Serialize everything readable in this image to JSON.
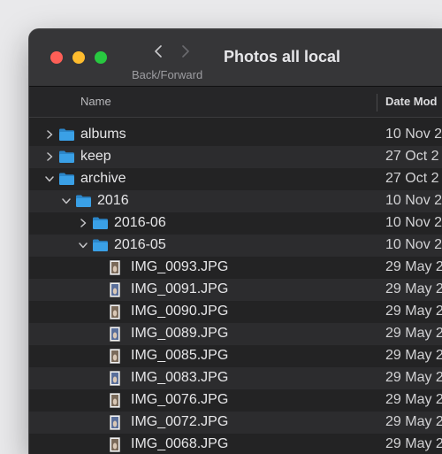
{
  "window": {
    "title": "Photos all local",
    "nav_label": "Back/Forward"
  },
  "columns": {
    "name": "Name",
    "date_modified": "Date Mod"
  },
  "rows": [
    {
      "name": "albums",
      "date": "10 Nov 2",
      "kind": "folder",
      "depth": 0,
      "expanded": false
    },
    {
      "name": "keep",
      "date": "27 Oct 2",
      "kind": "folder",
      "depth": 0,
      "expanded": false
    },
    {
      "name": "archive",
      "date": "27 Oct 2",
      "kind": "folder",
      "depth": 0,
      "expanded": true
    },
    {
      "name": "2016",
      "date": "10 Nov 2",
      "kind": "folder",
      "depth": 1,
      "expanded": true
    },
    {
      "name": "2016-06",
      "date": "10 Nov 2",
      "kind": "folder",
      "depth": 2,
      "expanded": false
    },
    {
      "name": "2016-05",
      "date": "10 Nov 2",
      "kind": "folder",
      "depth": 2,
      "expanded": true
    },
    {
      "name": "IMG_0093.JPG",
      "date": "29 May 2",
      "kind": "file",
      "depth": 3
    },
    {
      "name": "IMG_0091.JPG",
      "date": "29 May 2",
      "kind": "file",
      "depth": 3
    },
    {
      "name": "IMG_0090.JPG",
      "date": "29 May 2",
      "kind": "file",
      "depth": 3
    },
    {
      "name": "IMG_0089.JPG",
      "date": "29 May 2",
      "kind": "file",
      "depth": 3
    },
    {
      "name": "IMG_0085.JPG",
      "date": "29 May 2",
      "kind": "file",
      "depth": 3
    },
    {
      "name": "IMG_0083.JPG",
      "date": "29 May 2",
      "kind": "file",
      "depth": 3
    },
    {
      "name": "IMG_0076.JPG",
      "date": "29 May 2",
      "kind": "file",
      "depth": 3
    },
    {
      "name": "IMG_0072.JPG",
      "date": "29 May 2",
      "kind": "file",
      "depth": 3
    },
    {
      "name": "IMG_0068.JPG",
      "date": "29 May 2",
      "kind": "file",
      "depth": 3
    }
  ],
  "icons": {
    "close": "close-icon",
    "minimize": "minimize-icon",
    "zoom": "zoom-icon",
    "back": "chevron-left-icon",
    "forward": "chevron-right-icon",
    "folder": "folder-icon",
    "image_file": "image-file-icon",
    "disclosure_collapsed": "chevron-right-icon",
    "disclosure_expanded": "chevron-down-icon"
  },
  "colors": {
    "folder": "#3aa0e6",
    "close": "#fe5f57",
    "minimize": "#febc2e",
    "zoom": "#28c840"
  }
}
